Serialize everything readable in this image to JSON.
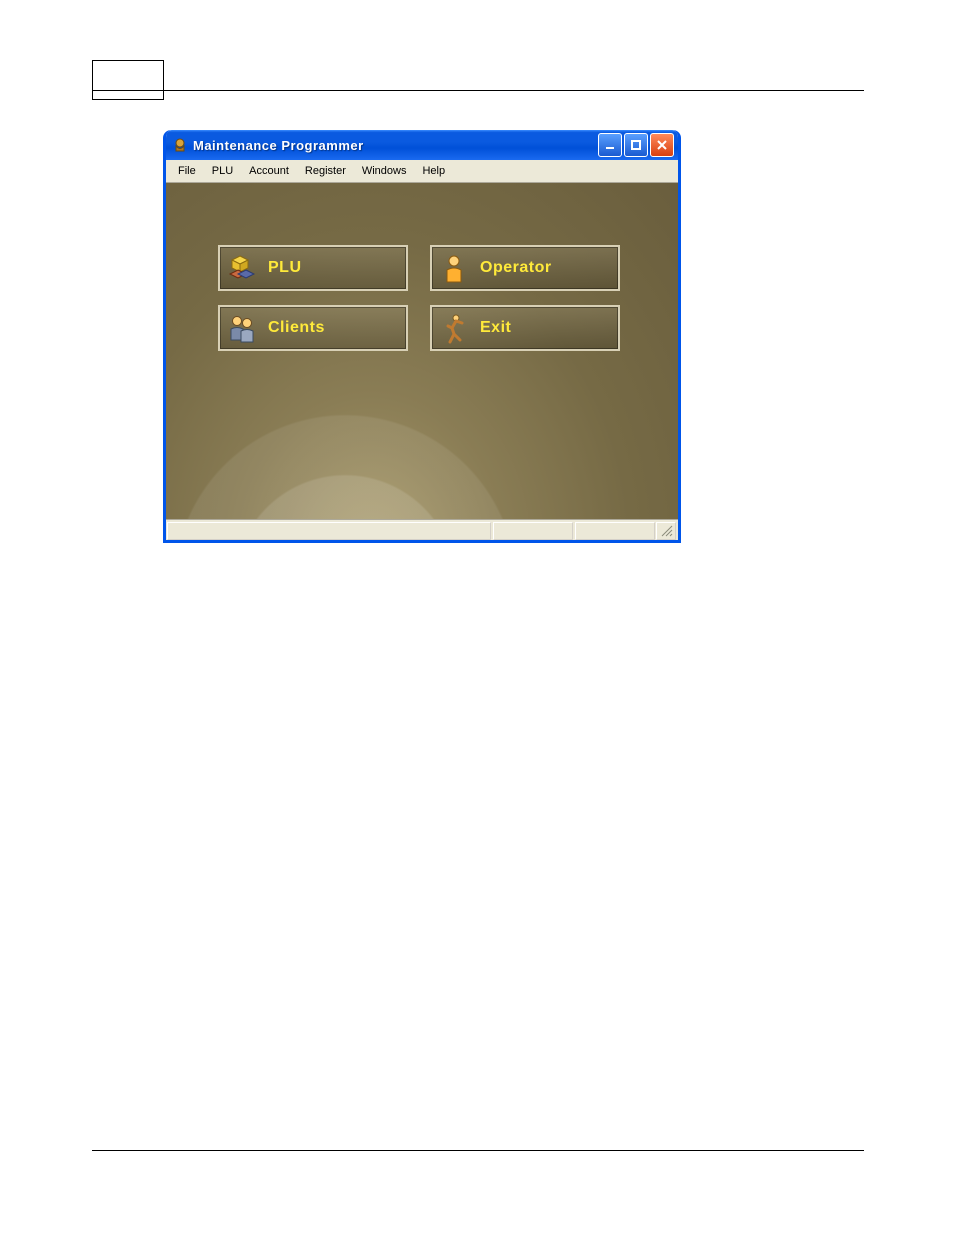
{
  "window_title": "Maintenance Programmer",
  "menu": {
    "items": [
      "File",
      "PLU",
      "Account",
      "Register",
      "Windows",
      "Help"
    ]
  },
  "buttons": {
    "plu": {
      "label": "PLU"
    },
    "operator": {
      "label": "Operator"
    },
    "clients": {
      "label": "Clients"
    },
    "exit": {
      "label": "Exit"
    }
  }
}
